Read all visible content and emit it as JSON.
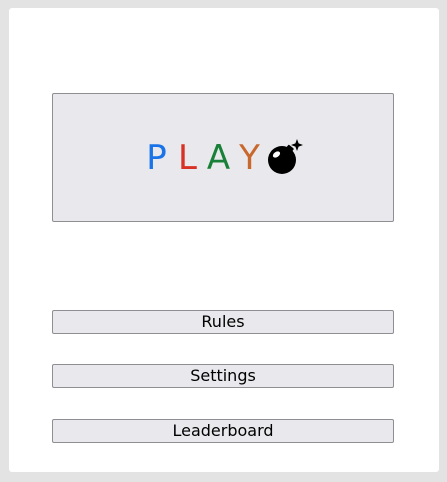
{
  "play": {
    "letters": [
      {
        "char": "P",
        "color": "#1a73e8"
      },
      {
        "char": "L",
        "color": "#d93025"
      },
      {
        "char": "A",
        "color": "#188038"
      },
      {
        "char": "Y",
        "color": "#c9682c"
      }
    ],
    "icon": "bomb-icon"
  },
  "menu": {
    "rules_label": "Rules",
    "settings_label": "Settings",
    "leaderboard_label": "Leaderboard"
  },
  "colors": {
    "button_bg": "#e9e8ed",
    "button_border": "#8e8e93",
    "window_bg": "#ffffff",
    "frame_bg": "#e3e3e3"
  }
}
